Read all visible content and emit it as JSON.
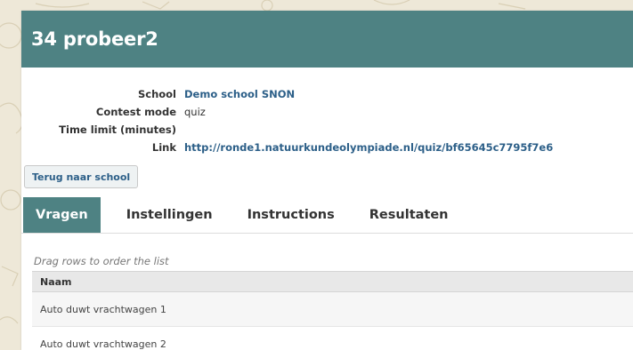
{
  "page": {
    "title": "34 probeer2"
  },
  "info": {
    "school_label": "School",
    "school_value": "Demo school SNON",
    "mode_label": "Contest mode",
    "mode_value": "quiz",
    "time_label": "Time limit (minutes)",
    "time_value": "",
    "link_label": "Link",
    "link_value": "http://ronde1.natuurkundeolympiade.nl/quiz/bf65645c7795f7e6"
  },
  "back_button": "Terug naar school",
  "tabs": [
    "Vragen",
    "Instellingen",
    "Instructions",
    "Resultaten"
  ],
  "content": {
    "hint": "Drag rows to order the list",
    "column_header": "Naam",
    "rows": [
      "Auto duwt vrachtwagen 1",
      "Auto duwt vrachtwagen 2"
    ]
  },
  "colors": {
    "accent": "#4e8283",
    "link": "#2c5f88",
    "background": "#eee8d8"
  }
}
